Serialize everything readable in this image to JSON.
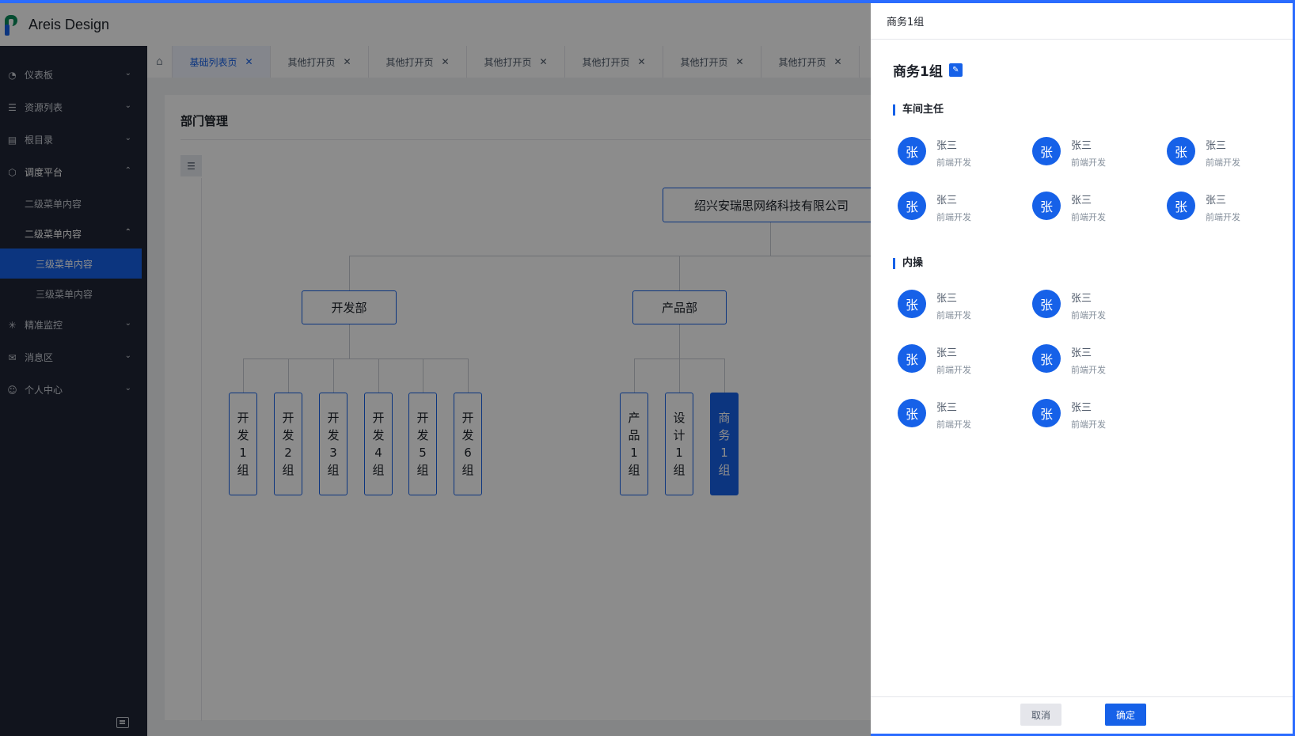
{
  "app": {
    "title": "Areis Design"
  },
  "sidebar": {
    "items": [
      {
        "label": "仪表板",
        "icon": "gauge-icon"
      },
      {
        "label": "资源列表",
        "icon": "list-icon"
      },
      {
        "label": "根目录",
        "icon": "folder-icon"
      },
      {
        "label": "调度平台",
        "icon": "cube-icon",
        "expanded": true
      },
      {
        "label": "精准监控",
        "icon": "monitor-icon"
      },
      {
        "label": "消息区",
        "icon": "mail-icon"
      },
      {
        "label": "个人中心",
        "icon": "user-icon"
      }
    ],
    "sub_items": [
      "二级菜单内容",
      "二级菜单内容"
    ],
    "third_items": [
      "三级菜单内容",
      "三级菜单内容"
    ]
  },
  "tabs": [
    {
      "label": "基础列表页",
      "active": true
    },
    {
      "label": "其他打开页"
    },
    {
      "label": "其他打开页"
    },
    {
      "label": "其他打开页"
    },
    {
      "label": "其他打开页"
    },
    {
      "label": "其他打开页"
    },
    {
      "label": "其他打开页"
    }
  ],
  "page": {
    "title": "部门管理"
  },
  "org": {
    "root": "绍兴安瑞思网络科技有限公司",
    "departments": [
      {
        "name": "开发部",
        "groups": [
          "开发1组",
          "开发2组",
          "开发3组",
          "开发4组",
          "开发5组",
          "开发6组"
        ]
      },
      {
        "name": "产品部",
        "groups": [
          "产品1组",
          "设计1组",
          "商务1组"
        ]
      }
    ],
    "selected_group": "商务1组"
  },
  "drawer": {
    "header": "商务1组",
    "name": "商务1组",
    "sections": [
      {
        "title": "车间主任",
        "members": [
          {
            "avatar": "张",
            "name": "张三",
            "role": "前端开发"
          },
          {
            "avatar": "张",
            "name": "张三",
            "role": "前端开发"
          },
          {
            "avatar": "张",
            "name": "张三",
            "role": "前端开发"
          },
          {
            "avatar": "张",
            "name": "张三",
            "role": "前端开发"
          },
          {
            "avatar": "张",
            "name": "张三",
            "role": "前端开发"
          },
          {
            "avatar": "张",
            "name": "张三",
            "role": "前端开发"
          }
        ]
      },
      {
        "title": "内操",
        "members": [
          {
            "avatar": "张",
            "name": "张三",
            "role": "前端开发"
          },
          {
            "avatar": "张",
            "name": "张三",
            "role": "前端开发"
          },
          {
            "avatar": "张",
            "name": "张三",
            "role": "前端开发"
          },
          {
            "avatar": "张",
            "name": "张三",
            "role": "前端开发"
          },
          {
            "avatar": "张",
            "name": "张三",
            "role": "前端开发"
          },
          {
            "avatar": "张",
            "name": "张三",
            "role": "前端开发"
          }
        ]
      }
    ],
    "cancel_label": "取消",
    "ok_label": "确定"
  },
  "colors": {
    "accent": "#1661e8",
    "sidebar_bg": "#1f2535",
    "overlay": "rgba(0,0,0,0.45)"
  }
}
